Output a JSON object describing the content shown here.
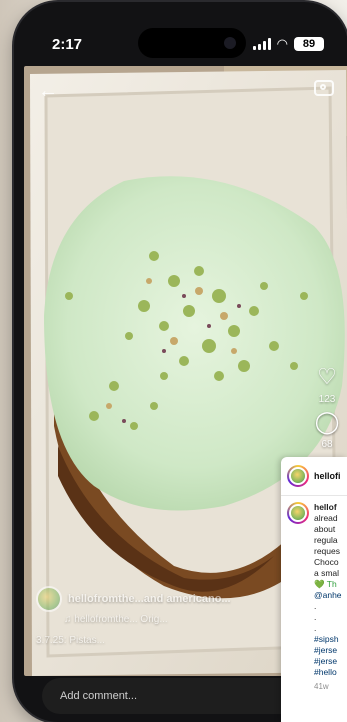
{
  "status_bar": {
    "time": "2:17",
    "battery": "89"
  },
  "post": {
    "author": "hellofromthe...and americano...",
    "music": "hellofromthe... Orig...",
    "caption": "3.7.25: Pistas...",
    "like_count": "123",
    "comment_count": "68"
  },
  "comment_input": {
    "placeholder": "Add comment..."
  },
  "side_panel": {
    "username": "hellofi",
    "lines": [
      {
        "text": "hellof",
        "style": "u"
      },
      {
        "text": "alread",
        "style": ""
      },
      {
        "text": "about",
        "style": ""
      },
      {
        "text": "regula",
        "style": ""
      },
      {
        "text": "reques",
        "style": ""
      },
      {
        "text": "Choco",
        "style": ""
      },
      {
        "text": "a smal",
        "style": ""
      },
      {
        "text": "💚 Th",
        "style": "heart-green"
      },
      {
        "text": "@anhe",
        "style": "link"
      },
      {
        "text": ".",
        "style": ""
      },
      {
        "text": ".",
        "style": ""
      },
      {
        "text": ".",
        "style": ""
      },
      {
        "text": "#sipsh",
        "style": "link"
      },
      {
        "text": "#jerse",
        "style": "link"
      },
      {
        "text": "#jerse",
        "style": "link"
      },
      {
        "text": "#hello",
        "style": "link"
      }
    ],
    "timestamp": "41w"
  },
  "colors": {
    "frosting": "#d9edd0",
    "pistachio": "#9bb65a",
    "container": "#ece7dc",
    "bun": "#7a4a22"
  }
}
